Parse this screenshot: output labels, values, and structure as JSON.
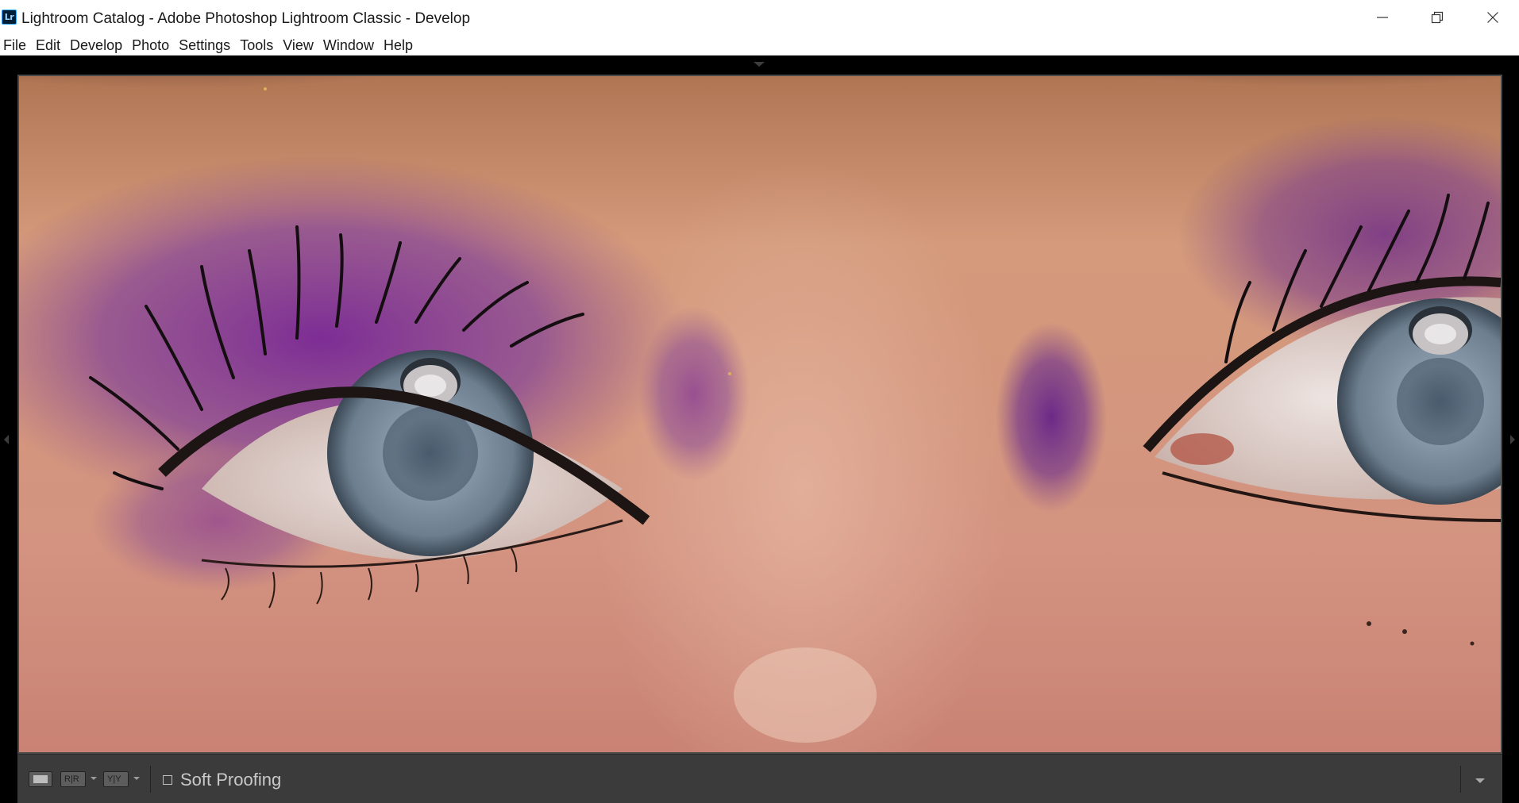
{
  "window": {
    "app_icon_text": "Lr",
    "title": "Lightroom Catalog - Adobe Photoshop Lightroom Classic - Develop"
  },
  "menu": [
    "File",
    "Edit",
    "Develop",
    "Photo",
    "Settings",
    "Tools",
    "View",
    "Window",
    "Help"
  ],
  "photo": {
    "subject": "close-up-eyes-purple-eyeshadow"
  },
  "toolbar": {
    "compare_label": "R|R",
    "before_after_label": "Y|Y",
    "soft_proofing_label": "Soft Proofing",
    "soft_proofing_checked": false
  },
  "colors": {
    "workspace_bg": "#000000",
    "toolbar_bg": "#3b3b3b",
    "skin": "#d99f86",
    "eyeshadow": "#7a3a8e",
    "iris": "#7d8e9e"
  }
}
